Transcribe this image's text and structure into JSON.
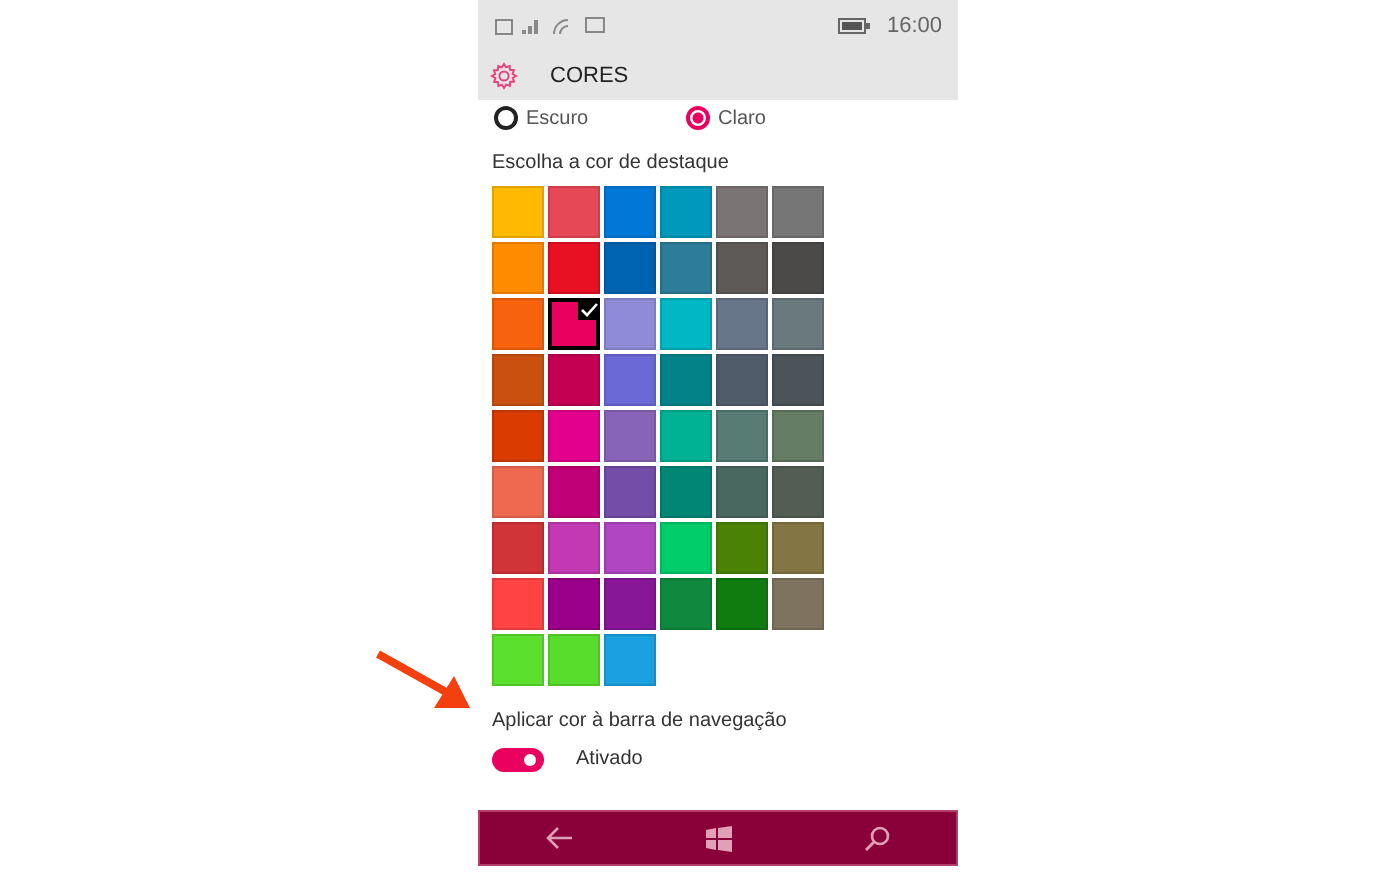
{
  "status_bar": {
    "time": "16:00"
  },
  "header": {
    "title": "CORES"
  },
  "theme_options": [
    {
      "label": "Escuro",
      "selected": false
    },
    {
      "label": "Claro",
      "selected": true
    }
  ],
  "accent": {
    "label": "Escolha a cor de destaque",
    "swatches": [
      {
        "color": "#ffb900",
        "selected": false
      },
      {
        "color": "#e74856",
        "selected": false
      },
      {
        "color": "#0078d7",
        "selected": false
      },
      {
        "color": "#0099bc",
        "selected": false
      },
      {
        "color": "#7a7574",
        "selected": false
      },
      {
        "color": "#767676",
        "selected": false
      },
      {
        "color": "#ff8c00",
        "selected": false
      },
      {
        "color": "#e81123",
        "selected": false
      },
      {
        "color": "#0063b1",
        "selected": false
      },
      {
        "color": "#2d7d9a",
        "selected": false
      },
      {
        "color": "#5d5a58",
        "selected": false
      },
      {
        "color": "#4c4a48",
        "selected": false
      },
      {
        "color": "#f7630c",
        "selected": false
      },
      {
        "color": "#ea005e",
        "selected": true
      },
      {
        "color": "#8e8cd8",
        "selected": false
      },
      {
        "color": "#00b7c3",
        "selected": false
      },
      {
        "color": "#68768a",
        "selected": false
      },
      {
        "color": "#69797e",
        "selected": false
      },
      {
        "color": "#ca5010",
        "selected": false
      },
      {
        "color": "#c30052",
        "selected": false
      },
      {
        "color": "#6b69d6",
        "selected": false
      },
      {
        "color": "#038387",
        "selected": false
      },
      {
        "color": "#515c6b",
        "selected": false
      },
      {
        "color": "#4a5459",
        "selected": false
      },
      {
        "color": "#da3b01",
        "selected": false
      },
      {
        "color": "#e3008c",
        "selected": false
      },
      {
        "color": "#8764b8",
        "selected": false
      },
      {
        "color": "#00b294",
        "selected": false
      },
      {
        "color": "#567c73",
        "selected": false
      },
      {
        "color": "#647c64",
        "selected": false
      },
      {
        "color": "#ef6950",
        "selected": false
      },
      {
        "color": "#bf0077",
        "selected": false
      },
      {
        "color": "#744da9",
        "selected": false
      },
      {
        "color": "#018574",
        "selected": false
      },
      {
        "color": "#486860",
        "selected": false
      },
      {
        "color": "#525e54",
        "selected": false
      },
      {
        "color": "#d13438",
        "selected": false
      },
      {
        "color": "#c239b3",
        "selected": false
      },
      {
        "color": "#b146c2",
        "selected": false
      },
      {
        "color": "#00cc6a",
        "selected": false
      },
      {
        "color": "#498205",
        "selected": false
      },
      {
        "color": "#847545",
        "selected": false
      },
      {
        "color": "#ff4343",
        "selected": false
      },
      {
        "color": "#9a0089",
        "selected": false
      },
      {
        "color": "#881798",
        "selected": false
      },
      {
        "color": "#10893e",
        "selected": false
      },
      {
        "color": "#107c10",
        "selected": false
      },
      {
        "color": "#7e735f",
        "selected": false
      },
      {
        "color": "#5ce02e",
        "selected": false
      },
      {
        "color": "#59dd2c",
        "selected": false
      },
      {
        "color": "#1ba1e2",
        "selected": false
      }
    ]
  },
  "nav_color": {
    "label": "Aplicar cor à barra de navegação",
    "toggle": {
      "on": true,
      "label": "Ativado"
    }
  }
}
